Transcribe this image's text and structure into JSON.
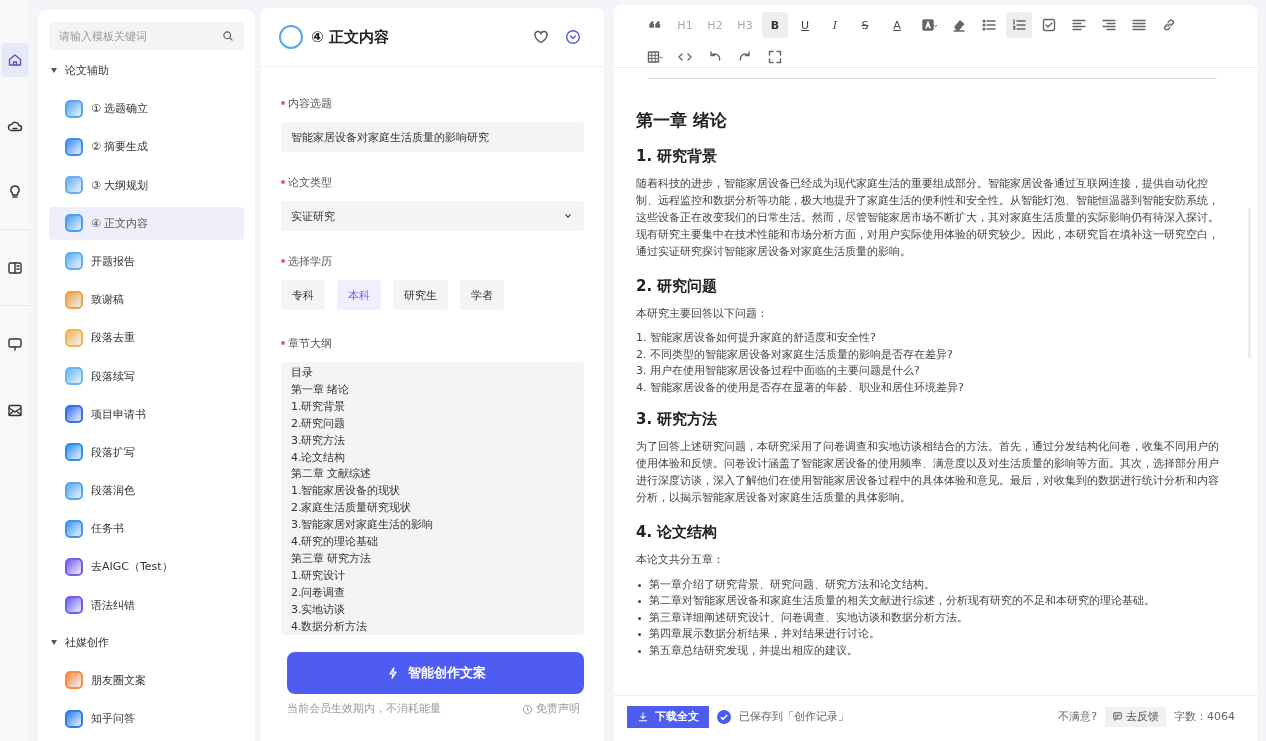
{
  "rail": [
    {
      "selected": true
    },
    {
      "selected": false
    },
    {
      "selected": false
    },
    {
      "selected": false
    },
    {
      "selected": false
    },
    {
      "selected": false
    }
  ],
  "sidebar": {
    "search": {
      "placeholder": "请输入模板关键词"
    },
    "groups": [
      {
        "title": "论文辅助",
        "expanded": true,
        "items": [
          {
            "label": "① 选题确立",
            "selected": false
          },
          {
            "label": "② 摘要生成",
            "selected": false
          },
          {
            "label": "③ 大纲规划",
            "selected": false
          },
          {
            "label": "④ 正文内容",
            "selected": true
          },
          {
            "label": "开题报告",
            "selected": false
          },
          {
            "label": "致谢稿",
            "selected": false
          },
          {
            "label": "段落去重",
            "selected": false
          },
          {
            "label": "段落续写",
            "selected": false
          },
          {
            "label": "项目申请书",
            "selected": false
          },
          {
            "label": "段落扩写",
            "selected": false
          },
          {
            "label": "段落润色",
            "selected": false
          },
          {
            "label": "任务书",
            "selected": false
          },
          {
            "label": "去AIGC（Test）",
            "selected": false
          },
          {
            "label": "语法纠错",
            "selected": false
          }
        ]
      },
      {
        "title": "社媒创作",
        "expanded": true,
        "items": [
          {
            "label": "朋友圈文案",
            "selected": false
          },
          {
            "label": "知乎问答",
            "selected": false
          }
        ]
      }
    ]
  },
  "form": {
    "title": "④ 正文内容",
    "fields": [
      {
        "kind": "input",
        "label": "内容选题",
        "required": true,
        "value": "智能家居设备对家庭生活质量的影响研究"
      },
      {
        "kind": "select",
        "label": "论文类型",
        "required": true,
        "value": "实证研究"
      },
      {
        "kind": "chips",
        "label": "选择学历",
        "required": true,
        "options": [
          {
            "label": "专科",
            "selected": false
          },
          {
            "label": "本科",
            "selected": true
          },
          {
            "label": "研究生",
            "selected": false
          },
          {
            "label": "学者",
            "selected": false
          }
        ]
      },
      {
        "kind": "textarea",
        "label": "章节大纲",
        "required": true,
        "lines": [
          "目录",
          "第一章 绪论",
          "1.研究背景",
          "2.研究问题",
          "3.研究方法",
          "4.论文结构",
          "第二章 文献综述",
          "1.智能家居设备的现状",
          "2.家庭生活质量研究现状",
          "3.智能家居对家庭生活的影响",
          "4.研究的理论基础",
          "第三章 研究方法",
          "1.研究设计",
          "2.问卷调查",
          "3.实地访谈",
          "4.数据分析方法"
        ]
      }
    ],
    "submit": "智能创作文案",
    "note": "当前会员生效期内，不消耗能量",
    "disclaimer": "免责声明"
  },
  "editor": {
    "toolbar": [
      [
        {
          "kind": "icon",
          "active": false
        },
        {
          "kind": "text",
          "label": "H1",
          "active": false
        },
        {
          "kind": "text",
          "label": "H2",
          "active": false
        },
        {
          "kind": "text",
          "label": "H3",
          "active": false
        },
        {
          "kind": "text",
          "label": "B",
          "active": true
        },
        {
          "kind": "text",
          "label": "U",
          "active": false
        },
        {
          "kind": "text",
          "label": "I",
          "active": false
        },
        {
          "kind": "text",
          "label": "S",
          "active": false
        },
        {
          "kind": "text",
          "label": "A",
          "active": false
        },
        {
          "kind": "icon",
          "active": false
        },
        {
          "kind": "icon",
          "active": false
        },
        {
          "kind": "icon",
          "active": false
        },
        {
          "kind": "icon",
          "active": true
        },
        {
          "kind": "icon",
          "active": false
        },
        {
          "kind": "icon",
          "active": false
        },
        {
          "kind": "icon",
          "active": false
        },
        {
          "kind": "icon",
          "active": false
        },
        {
          "kind": "icon",
          "active": false
        }
      ],
      [
        {
          "kind": "icon",
          "active": false
        },
        {
          "kind": "icon",
          "active": false
        },
        {
          "kind": "icon",
          "active": false
        },
        {
          "kind": "icon",
          "active": false
        },
        {
          "kind": "icon",
          "active": false
        }
      ]
    ],
    "blocks": [
      {
        "kind": "h1",
        "text": "第一章 绪论"
      },
      {
        "kind": "h2",
        "text": "1. 研究背景"
      },
      {
        "kind": "p",
        "text": "随着科技的进步，智能家居设备已经成为现代家庭生活的重要组成部分。智能家居设备通过互联网连接，提供自动化控制、远程监控和数据分析等功能，极大地提升了家庭生活的便利性和安全性。从智能灯泡、智能恒温器到智能安防系统，这些设备正在改变我们的日常生活。然而，尽管智能家居市场不断扩大，其对家庭生活质量的实际影响仍有待深入探讨。现有研究主要集中在技术性能和市场分析方面，对用户实际使用体验的研究较少。因此，本研究旨在填补这一研究空白，通过实证研究探讨智能家居设备对家庭生活质量的影响。"
      },
      {
        "kind": "h2",
        "text": "2. 研究问题"
      },
      {
        "kind": "p",
        "text": "本研究主要回答以下问题："
      },
      {
        "kind": "ol",
        "items": [
          "1. 智能家居设备如何提升家庭的舒适度和安全性?",
          "2. 不同类型的智能家居设备对家庭生活质量的影响是否存在差异?",
          "3. 用户在使用智能家居设备过程中面临的主要问题是什么?",
          "4. 智能家居设备的使用是否存在显著的年龄、职业和居住环境差异?"
        ]
      },
      {
        "kind": "h2",
        "text": "3. 研究方法"
      },
      {
        "kind": "p",
        "text": "为了回答上述研究问题，本研究采用了问卷调查和实地访谈相结合的方法。首先，通过分发结构化问卷，收集不同用户的使用体验和反馈。问卷设计涵盖了智能家居设备的使用频率、满意度以及对生活质量的影响等方面。其次，选择部分用户进行深度访谈，深入了解他们在使用智能家居设备过程中的具体体验和意见。最后，对收集到的数据进行统计分析和内容分析，以揭示智能家居设备对家庭生活质量的具体影响。"
      },
      {
        "kind": "h2",
        "text": "4. 论文结构"
      },
      {
        "kind": "p",
        "text": "本论文共分五章："
      },
      {
        "kind": "ul",
        "items": [
          "第一章介绍了研究背景、研究问题、研究方法和论文结构。",
          "第二章对智能家居设备和家庭生活质量的相关文献进行综述，分析现有研究的不足和本研究的理论基础。",
          "第三章详细阐述研究设计、问卷调查、实地访谈和数据分析方法。",
          "第四章展示数据分析结果，并对结果进行讨论。",
          "第五章总结研究发现，并提出相应的建议。"
        ]
      }
    ],
    "footer": {
      "download": "下载全文",
      "saved": "已保存到「创作记录」",
      "unsatisfied": "不满意?",
      "feedback": "去反馈",
      "count": "字数：4064"
    }
  }
}
